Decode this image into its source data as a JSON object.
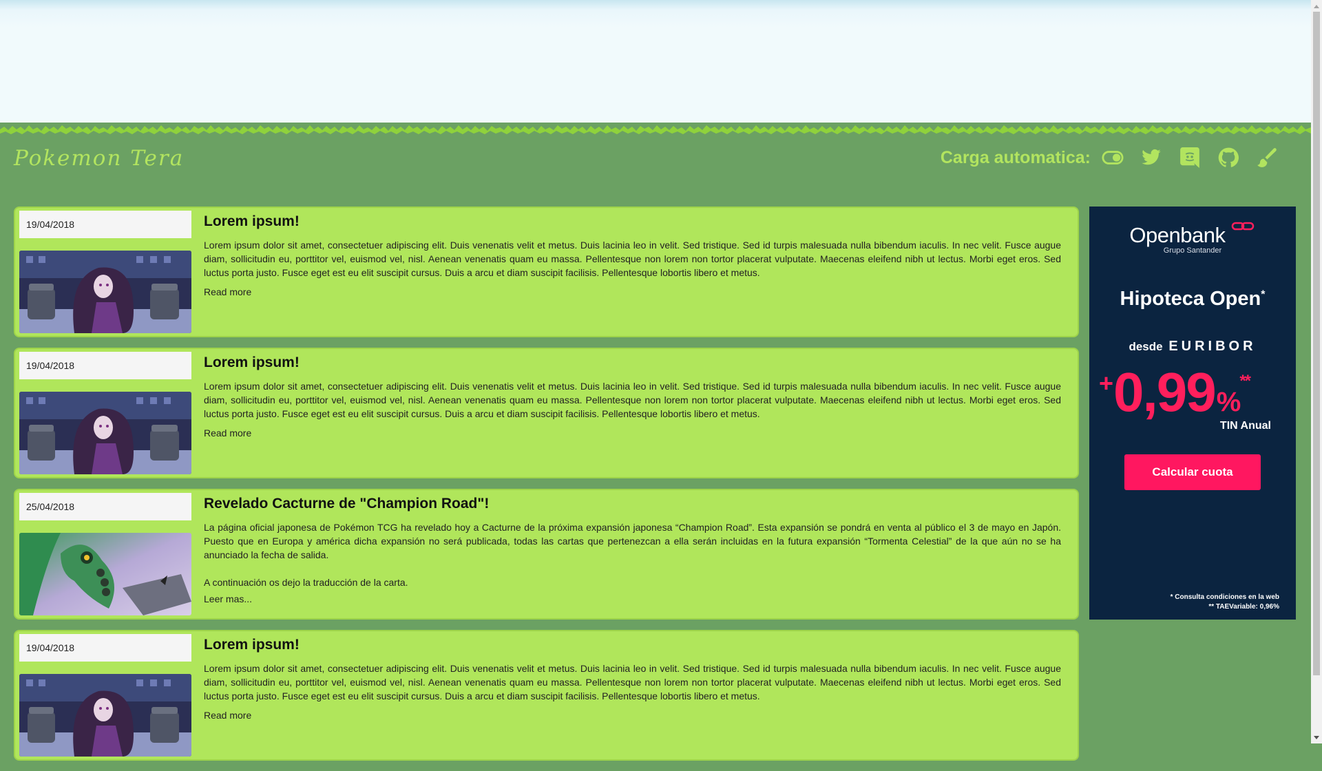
{
  "brand": "Pokemon Tera",
  "toolbar": {
    "auto_load_label": "Carga automatica:",
    "icons": [
      "toggle-icon",
      "twitter-icon",
      "discord-icon",
      "github-icon",
      "brush-icon"
    ]
  },
  "posts": [
    {
      "date": "19/04/2018",
      "title": "Lorem ipsum!",
      "body": "Lorem ipsum dolor sit amet, consectetuer adipiscing elit. Duis venenatis velit et metus. Duis lacinia leo in velit. Sed tristique. Sed id turpis malesuada nulla bibendum iaculis. In nec velit. Fusce augue diam, sollicitudin eu, porttitor vel, euismod vel, nisl. Aenean venenatis quam eu massa. Pellentesque non lorem non tortor placerat vulputate. Maecenas eleifend nibh ut lectus. Morbi eget eros. Sed luctus porta justo. Fusce eget est eu elit suscipit cursus. Duis a arcu et diam suscipit facilisis. Pellentesque lobortis libero et metus.",
      "body2": "",
      "link": "Read more"
    },
    {
      "date": "19/04/2018",
      "title": "Lorem ipsum!",
      "body": "Lorem ipsum dolor sit amet, consectetuer adipiscing elit. Duis venenatis velit et metus. Duis lacinia leo in velit. Sed tristique. Sed id turpis malesuada nulla bibendum iaculis. In nec velit. Fusce augue diam, sollicitudin eu, porttitor vel, euismod vel, nisl. Aenean venenatis quam eu massa. Pellentesque non lorem non tortor placerat vulputate. Maecenas eleifend nibh ut lectus. Morbi eget eros. Sed luctus porta justo. Fusce eget est eu elit suscipit cursus. Duis a arcu et diam suscipit facilisis. Pellentesque lobortis libero et metus.",
      "body2": "",
      "link": "Read more"
    },
    {
      "date": "25/04/2018",
      "title": "Revelado Cacturne de \"Champion Road\"!",
      "body": "La página oficial japonesa de Pokémon TCG ha revelado hoy a Cacturne de la próxima expansión japonesa “Champion Road”. Esta expansión se pondrá en venta al público el 3 de mayo en Japón. Puesto que en Europa y américa dicha expansión no será publicada, todas las cartas que pertenezcan a ella serán incluidas en la futura expansión “Tormenta Celestial” de la que aún no se ha anunciado la fecha de salida.",
      "body2": "A continuación os dejo la traducción de la carta.",
      "link": "Leer mas..."
    },
    {
      "date": "19/04/2018",
      "title": "Lorem ipsum!",
      "body": "Lorem ipsum dolor sit amet, consectetuer adipiscing elit. Duis venenatis velit et metus. Duis lacinia leo in velit. Sed tristique. Sed id turpis malesuada nulla bibendum iaculis. In nec velit. Fusce augue diam, sollicitudin eu, porttitor vel, euismod vel, nisl. Aenean venenatis quam eu massa. Pellentesque non lorem non tortor placerat vulputate. Maecenas eleifend nibh ut lectus. Morbi eget eros. Sed luctus porta justo. Fusce eget est eu elit suscipit cursus. Duis a arcu et diam suscipit facilisis. Pellentesque lobortis libero et metus.",
      "body2": "",
      "link": "Read more"
    }
  ],
  "ad": {
    "logo": "Openbank",
    "sub": "Grupo Santander",
    "title": "Hipoteca Open",
    "title_mark": "*",
    "desde": "desde",
    "euribor": "EURIBOR",
    "plus": "+",
    "rate": "0,99",
    "pct": "%",
    "rate_mark": "**",
    "tin": "TIN Anual",
    "button": "Calcular cuota",
    "legal1": "* Consulta condiciones en la web",
    "legal2": "** TAEVariable: 0,96%"
  },
  "colors": {
    "page_bg": "#6ba163",
    "card_bg": "#b0e65b",
    "brand": "#b2e45f",
    "ad_bg": "#0b2440",
    "ad_accent": "#ff1760"
  }
}
